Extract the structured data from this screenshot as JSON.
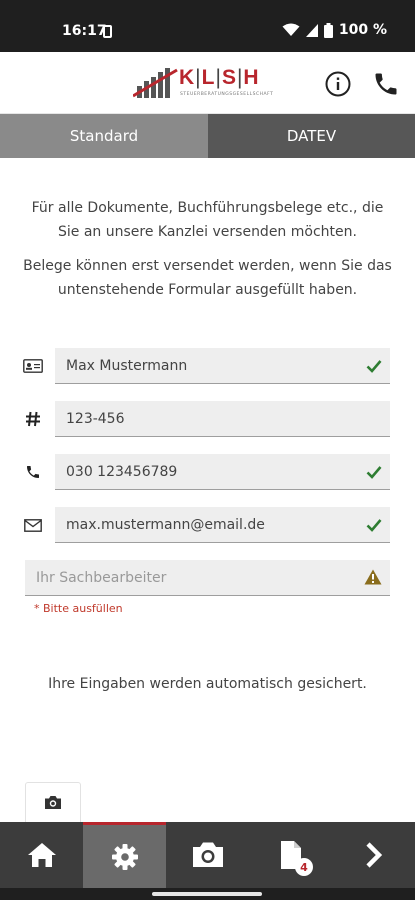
{
  "status_bar": {
    "time": "16:17",
    "battery": "100 %"
  },
  "header": {
    "logo_text": "K|L|S|H",
    "logo_parts": [
      "K",
      "L",
      "S",
      "H"
    ],
    "logo_subtitle": "STEUERBERATUNGSGESELLSCHAFT",
    "info_icon": "info-icon",
    "phone_icon": "phone-icon"
  },
  "tabs": [
    {
      "label": "Standard",
      "selected": true
    },
    {
      "label": "DATEV",
      "selected": false
    }
  ],
  "intro": {
    "paragraph1": "Für alle Dokumente, Buchführungsbelege etc., die Sie an unsere Kanzlei versenden möchten.",
    "paragraph2": "Belege können erst versendet werden, wenn Sie das untenstehende Formular ausgefüllt haben."
  },
  "form": {
    "name": {
      "icon": "id-card-icon",
      "value": "Max Mustermann",
      "status": "valid"
    },
    "client_number": {
      "icon": "hash-icon",
      "value": "123-456"
    },
    "phone": {
      "icon": "phone-icon",
      "value": "030 123456789",
      "status": "valid"
    },
    "email": {
      "icon": "mail-icon",
      "value": "max.mustermann@email.de",
      "status": "valid"
    },
    "clerk": {
      "placeholder": "Ihr Sachbearbeiter",
      "value": "",
      "status": "warning",
      "error": "* Bitte ausfüllen"
    }
  },
  "autosave_note": "Ihre Eingaben werden automatisch gesichert.",
  "bottom_nav": {
    "items": [
      {
        "icon": "home-icon",
        "active": false
      },
      {
        "icon": "gear-icon",
        "active": true
      },
      {
        "icon": "camera-icon",
        "active": false
      },
      {
        "icon": "document-icon",
        "active": false,
        "badge": "4"
      },
      {
        "icon": "chevron-right-icon",
        "active": false
      }
    ]
  },
  "colors": {
    "accent": "#b8262d",
    "valid": "#2e7d32",
    "warning": "#8a6d1d",
    "nav_bg": "#3c3c3c"
  }
}
